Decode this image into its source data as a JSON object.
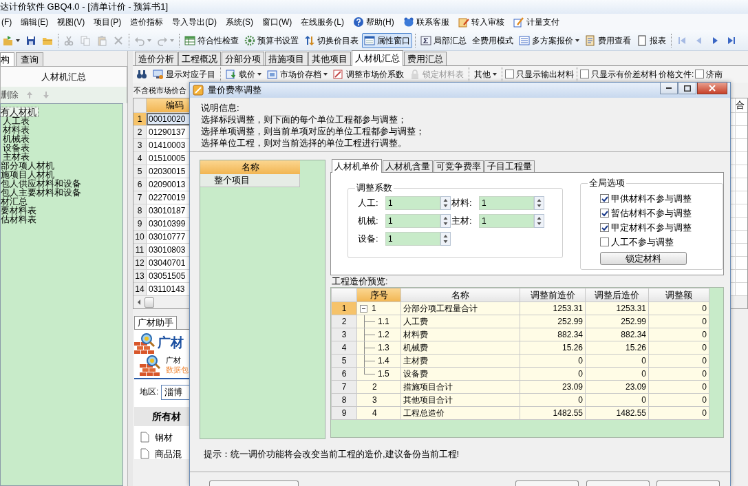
{
  "window": {
    "title": "达计价软件 GBQ4.0 - [清单计价 - 预算书1]"
  },
  "menu": [
    "(F)",
    "编辑(E)",
    "视图(V)",
    "项目(P)",
    "造价指标",
    "导入导出(D)",
    "系统(S)",
    "窗口(W)",
    "在线服务(L)",
    "帮助(H)",
    "联系客服",
    "转入审核",
    "计量支付"
  ],
  "toolbar": [
    {
      "kind": "icon",
      "disabled": false,
      "dropdown": true
    },
    {
      "kind": "icon",
      "disabled": false,
      "dropdown": false
    },
    {
      "kind": "icon",
      "disabled": false,
      "dropdown": false
    },
    {
      "kind": "separator"
    },
    {
      "kind": "icon",
      "disabled": true,
      "dropdown": false
    },
    {
      "kind": "icon",
      "disabled": true,
      "dropdown": false
    },
    {
      "kind": "icon",
      "disabled": true,
      "dropdown": false
    },
    {
      "kind": "icon",
      "disabled": true,
      "dropdown": false
    },
    {
      "kind": "separator"
    },
    {
      "kind": "icon",
      "disabled": true,
      "dropdown": true
    },
    {
      "kind": "icon",
      "disabled": true,
      "dropdown": true
    },
    {
      "kind": "separator"
    },
    {
      "kind": "button",
      "label": "符合性检查",
      "pressed": false,
      "dropdown": false
    },
    {
      "kind": "button",
      "label": "预算书设置",
      "pressed": false,
      "dropdown": false
    },
    {
      "kind": "button",
      "label": "切换价目表",
      "pressed": false,
      "dropdown": false
    },
    {
      "kind": "button",
      "label": "属性窗口",
      "pressed": true,
      "dropdown": false
    },
    {
      "kind": "separator"
    },
    {
      "kind": "button",
      "label": "局部汇总",
      "pressed": false,
      "dropdown": false
    },
    {
      "kind": "text",
      "label": "全费用模式",
      "pressed": false,
      "dropdown": false
    },
    {
      "kind": "button",
      "label": "多方案报价",
      "pressed": false,
      "dropdown": true
    },
    {
      "kind": "button",
      "label": "费用查看",
      "pressed": false,
      "dropdown": false
    },
    {
      "kind": "button",
      "label": "报表",
      "pressed": false,
      "dropdown": false
    },
    {
      "kind": "separator"
    },
    {
      "kind": "icon",
      "disabled": true,
      "dropdown": false
    },
    {
      "kind": "icon",
      "disabled": true,
      "dropdown": false
    },
    {
      "kind": "icon",
      "disabled": false,
      "dropdown": false
    },
    {
      "kind": "icon",
      "disabled": false,
      "dropdown": false
    }
  ],
  "left_tabs": [
    {
      "label": "构",
      "selected": true
    },
    {
      "label": "查询",
      "selected": false
    }
  ],
  "left_panel": {
    "title": "人材机汇总",
    "delete": "删除",
    "tree": [
      {
        "label": "有人材机",
        "selected": true,
        "children": [
          {
            "label": "人工表",
            "selected": false
          },
          {
            "label": "材料表",
            "selected": false
          },
          {
            "label": "机械表",
            "selected": false
          },
          {
            "label": "设备表",
            "selected": false
          },
          {
            "label": "主材表",
            "selected": false
          }
        ]
      },
      {
        "label": "部分项人材机",
        "selected": false
      },
      {
        "label": "施项目人材机",
        "selected": false
      },
      {
        "label": "包人供应材料和设备",
        "selected": false
      },
      {
        "label": "包人主要材料和设备",
        "selected": false
      },
      {
        "label": "材汇总",
        "selected": false
      },
      {
        "label": "要材料表",
        "selected": false
      },
      {
        "label": "估材料表",
        "selected": false
      }
    ]
  },
  "module_tabs": [
    {
      "label": "造价分析",
      "selected": false
    },
    {
      "label": "工程概况",
      "selected": false
    },
    {
      "label": "分部分项",
      "selected": false
    },
    {
      "label": "措施项目",
      "selected": false
    },
    {
      "label": "其他项目",
      "selected": false
    },
    {
      "label": "人材机汇总",
      "selected": true
    },
    {
      "label": "费用汇总",
      "selected": false
    }
  ],
  "sub_toolbar": [
    {
      "kind": "icon",
      "disabled": false,
      "dropdown": false
    },
    {
      "kind": "button",
      "label": "显示对应子目",
      "disabled": false,
      "dropdown": false
    },
    {
      "kind": "separator"
    },
    {
      "kind": "button",
      "label": "载价",
      "disabled": false,
      "dropdown": true
    },
    {
      "kind": "button",
      "label": "市场价存档",
      "disabled": false,
      "dropdown": true
    },
    {
      "kind": "button",
      "label": "调整市场价系数",
      "disabled": false,
      "dropdown": false
    },
    {
      "kind": "button",
      "label": "锁定材料表",
      "disabled": true,
      "dropdown": false
    },
    {
      "kind": "separator"
    },
    {
      "kind": "text",
      "label": "其他",
      "disabled": false,
      "dropdown": true
    },
    {
      "kind": "separator"
    },
    {
      "kind": "checkbox",
      "label": "只显示输出材料",
      "checked": false
    },
    {
      "kind": "separator"
    },
    {
      "kind": "checkbox",
      "label": "只显示有价差材料",
      "checked": false
    },
    {
      "kind": "label",
      "label": "价格文件:"
    },
    {
      "kind": "checkbox",
      "label": "济南",
      "checked": false
    }
  ],
  "price_label": "不含税市场价合",
  "grid": {
    "columns": [
      "编码",
      "合"
    ],
    "rows": [
      {
        "num": "1",
        "code": "00010020",
        "selected": true
      },
      {
        "num": "2",
        "code": "01290137",
        "selected": false
      },
      {
        "num": "3",
        "code": "01410003",
        "selected": false
      },
      {
        "num": "4",
        "code": "01510005",
        "selected": false
      },
      {
        "num": "5",
        "code": "02030015",
        "selected": false
      },
      {
        "num": "6",
        "code": "02090013",
        "selected": false
      },
      {
        "num": "7",
        "code": "02270019",
        "selected": false
      },
      {
        "num": "8",
        "code": "03010187",
        "selected": false
      },
      {
        "num": "9",
        "code": "03010399",
        "selected": false
      },
      {
        "num": "10",
        "code": "03010777",
        "selected": false
      },
      {
        "num": "11",
        "code": "03010803",
        "selected": false
      },
      {
        "num": "12",
        "code": "03040701",
        "selected": false
      },
      {
        "num": "13",
        "code": "03051505",
        "selected": false
      },
      {
        "num": "14",
        "code": "03110143",
        "selected": false
      }
    ]
  },
  "assistant": {
    "tab": "广材助手",
    "brand": "广材",
    "line1": "广材",
    "line2": "数据包",
    "region_label": "地区:",
    "region": "淄博",
    "list_title": "所有材",
    "items": [
      "钢材",
      "商品混"
    ]
  },
  "dialog": {
    "title": "量价费率调整",
    "info": [
      "说明信息:",
      "选择标段调整，则下面的每个单位工程都参与调整；",
      "选择单项调整，则当前单项对应的单位工程都参与调整；",
      "选择单位工程，则对当前选择的单位工程进行调整。"
    ],
    "list": {
      "header": "名称",
      "rows": [
        "整个项目"
      ]
    },
    "tabs": [
      {
        "label": "人材机单价",
        "selected": true
      },
      {
        "label": "人材机含量",
        "selected": false
      },
      {
        "label": "可竞争费率",
        "selected": false
      },
      {
        "label": "子目工程量",
        "selected": false
      }
    ],
    "coefficients": {
      "title": "调整系数",
      "fields": [
        {
          "label": "人工:",
          "value": "1"
        },
        {
          "label": "材料:",
          "value": "1"
        },
        {
          "label": "机械:",
          "value": "1"
        },
        {
          "label": "主材:",
          "value": "1"
        },
        {
          "label": "设备:",
          "value": "1"
        }
      ]
    },
    "global_options": {
      "title": "全局选项",
      "options": [
        {
          "label": "甲供材料不参与调整",
          "checked": true
        },
        {
          "label": "暂估材料不参与调整",
          "checked": true
        },
        {
          "label": "甲定材料不参与调整",
          "checked": true
        },
        {
          "label": "人工不参与调整",
          "checked": false
        }
      ],
      "button": "锁定材料"
    },
    "preview": {
      "title": "工程造价预览:",
      "columns": [
        "序号",
        "名称",
        "调整前造价",
        "调整后造价",
        "调整额"
      ],
      "rows": [
        {
          "num": "1",
          "seq": "1",
          "name": "分部分项工程量合计",
          "before": "1253.31",
          "after": "1253.31",
          "diff": "0",
          "selected": true,
          "expanded": true,
          "children": [
            {
              "num": "2",
              "seq": "1.1",
              "name": "人工费",
              "before": "252.99",
              "after": "252.99",
              "diff": "0",
              "selected": false
            },
            {
              "num": "3",
              "seq": "1.2",
              "name": "材料费",
              "before": "882.34",
              "after": "882.34",
              "diff": "0",
              "selected": false
            },
            {
              "num": "4",
              "seq": "1.3",
              "name": "机械费",
              "before": "15.26",
              "after": "15.26",
              "diff": "0",
              "selected": false
            },
            {
              "num": "5",
              "seq": "1.4",
              "name": "主材费",
              "before": "0",
              "after": "0",
              "diff": "0",
              "selected": false
            },
            {
              "num": "6",
              "seq": "1.5",
              "name": "设备费",
              "before": "0",
              "after": "0",
              "diff": "0",
              "selected": false
            }
          ]
        },
        {
          "num": "7",
          "seq": "2",
          "name": "措施项目合计",
          "before": "23.09",
          "after": "23.09",
          "diff": "0",
          "selected": false
        },
        {
          "num": "8",
          "seq": "3",
          "name": "其他项目合计",
          "before": "0",
          "after": "0",
          "diff": "0",
          "selected": false
        },
        {
          "num": "9",
          "seq": "4",
          "name": "工程总造价",
          "before": "1482.55",
          "after": "1482.55",
          "diff": "0",
          "selected": false
        }
      ]
    },
    "hint": "提示：统一调价功能将会改变当前工程的造价,建议备份当前工程!"
  }
}
